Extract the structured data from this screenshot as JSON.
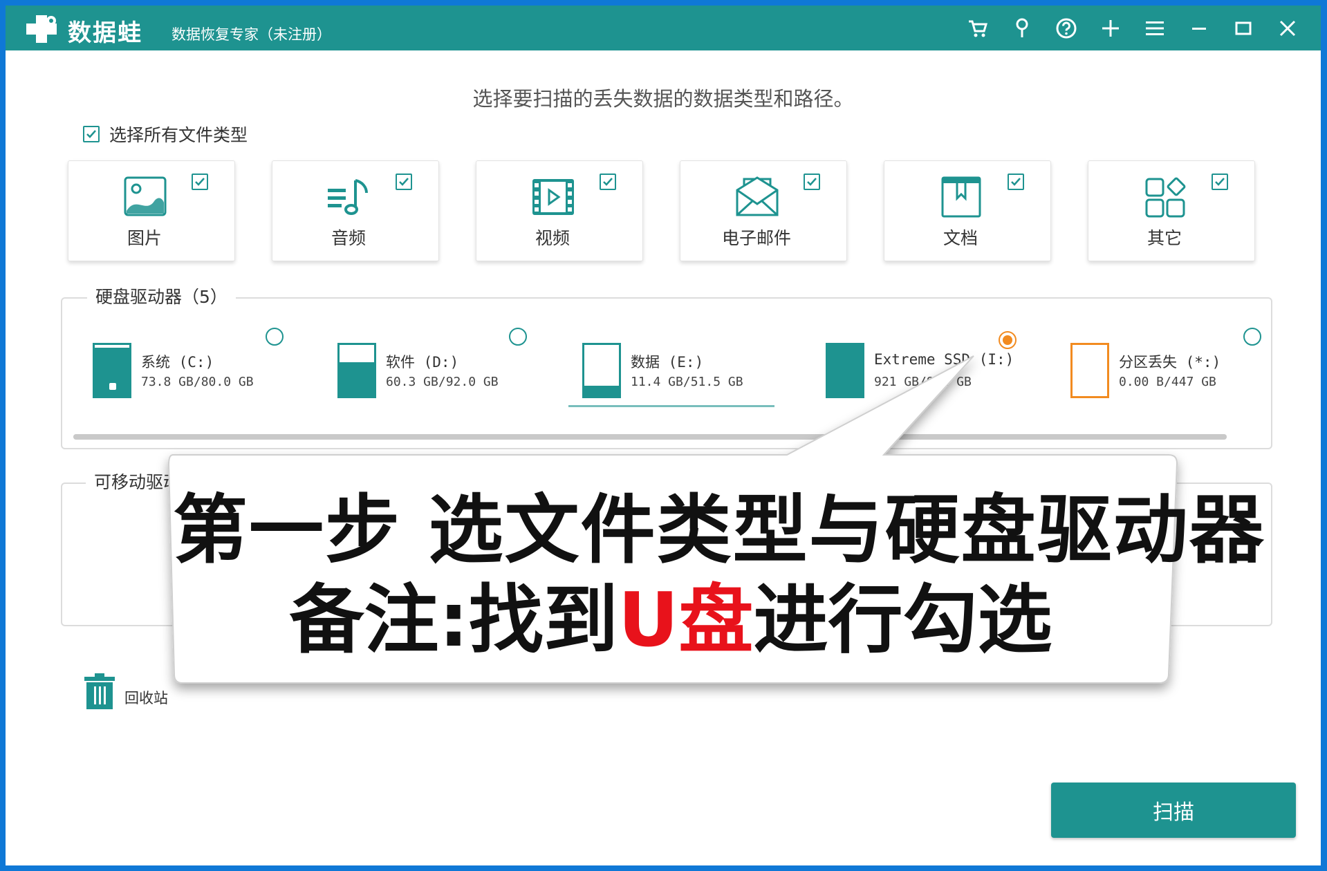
{
  "app": {
    "name": "数据蛙",
    "subtitle": "数据恢复专家（未注册）"
  },
  "titlebar_icons": [
    "cart-icon",
    "pin-icon",
    "help-icon",
    "plus-icon",
    "menu-icon",
    "minimize-icon",
    "maximize-icon",
    "close-icon"
  ],
  "headline": "选择要扫描的丢失数据的数据类型和路径。",
  "select_all": {
    "label": "选择所有文件类型",
    "checked": true
  },
  "file_types": [
    {
      "label": "图片",
      "icon": "image-icon",
      "checked": true
    },
    {
      "label": "音频",
      "icon": "audio-icon",
      "checked": true
    },
    {
      "label": "视频",
      "icon": "video-icon",
      "checked": true
    },
    {
      "label": "电子邮件",
      "icon": "email-icon",
      "checked": true
    },
    {
      "label": "文档",
      "icon": "document-icon",
      "checked": true
    },
    {
      "label": "其它",
      "icon": "other-icon",
      "checked": true
    }
  ],
  "hard_drives": {
    "title": "硬盘驱动器（5）",
    "drives": [
      {
        "name": "系统 (C:)",
        "size": "73.8 GB/80.0 GB",
        "fill": 0.92,
        "selected": false
      },
      {
        "name": "软件 (D:)",
        "size": "60.3 GB/92.0 GB",
        "fill": 0.66,
        "selected": false
      },
      {
        "name": "数据 (E:)",
        "size": "11.4 GB/51.5 GB",
        "fill": 0.22,
        "selected": false
      },
      {
        "name": "Extreme SSD (I:)",
        "size": "921 GB/932 GB",
        "fill": 0.99,
        "selected": true
      },
      {
        "name": "分区丢失 (*:)",
        "size": "0.00 B/447 GB",
        "fill": 0.0,
        "selected": false
      }
    ]
  },
  "removable_drives": {
    "title": "可移动驱动器"
  },
  "recycle_bin": {
    "label": "回收站",
    "icon": "trash-icon"
  },
  "scan_button": {
    "label": "扫描"
  },
  "callout": {
    "line1": "第一步 选文件类型与硬盘驱动器",
    "line2_prefix": "备注:找到",
    "line2_highlight": "U盘",
    "line2_suffix": "进行勾选"
  },
  "colors": {
    "brand": "#1e9390",
    "selected_radio": "#f28b20",
    "desktop": "#0f78d6",
    "highlight_text": "#e8121b"
  }
}
